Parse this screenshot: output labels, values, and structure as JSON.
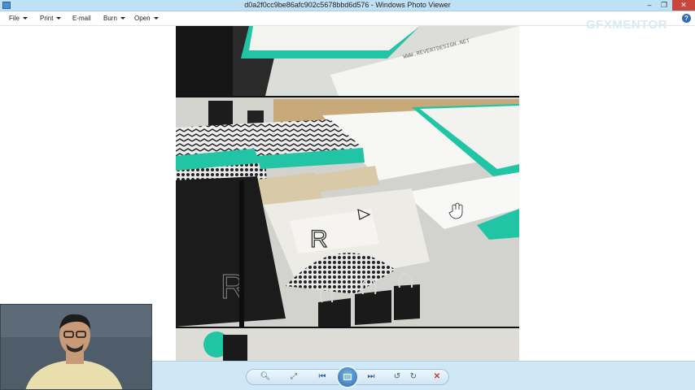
{
  "window": {
    "title": "d0a2f0cc9be86afc902c5678bbd6d576 - Windows Photo Viewer",
    "minimize_glyph": "–",
    "restore_glyph": "❐",
    "close_glyph": "✕"
  },
  "menu": {
    "items": [
      {
        "label": "File",
        "has_dropdown": true
      },
      {
        "label": "Print",
        "has_dropdown": true
      },
      {
        "label": "E-mail",
        "has_dropdown": false
      },
      {
        "label": "Burn",
        "has_dropdown": true
      },
      {
        "label": "Open",
        "has_dropdown": true
      }
    ],
    "help_glyph": "?"
  },
  "overlay": {
    "brand": "GFXMENTOR"
  },
  "photo": {
    "description_icon": "stationery-mockup-photo",
    "website_text": "WWW.REVERTDESIGN.NET",
    "monogram": "R"
  },
  "toolbar": {
    "zoom_glyph": "🔍︎",
    "fit_glyph": "⤢",
    "previous_glyph": "⏮",
    "slideshow_icon": "slideshow-icon",
    "next_glyph": "⏭",
    "rotate_ccw_glyph": "↺",
    "rotate_cw_glyph": "↻",
    "delete_glyph": "✕"
  },
  "colors": {
    "titlebar": "#bfe0f5",
    "toolbar": "#cfe7f7",
    "accent_teal": "#22c4a6",
    "close_red": "#c9463d"
  }
}
